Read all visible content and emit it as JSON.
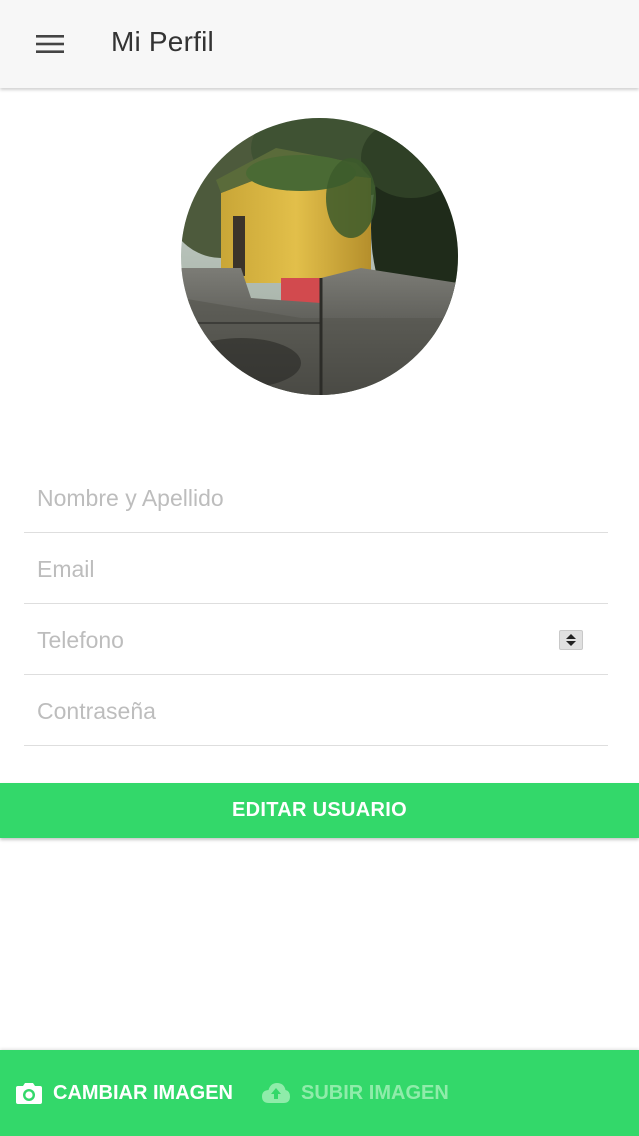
{
  "header": {
    "title": "Mi Perfil",
    "menu_icon": "hamburger-menu-icon",
    "background": "#f7f7f7"
  },
  "profile": {
    "avatar_alt": "Foto de perfil"
  },
  "form": {
    "name_placeholder": "Nombre y Apellido",
    "name_value": "",
    "email_placeholder": "Email",
    "email_value": "",
    "phone_placeholder": "Telefono",
    "phone_value": "",
    "password_placeholder": "Contraseña",
    "password_value": ""
  },
  "actions": {
    "edit_label": "EDITAR USUARIO"
  },
  "bottom_bar": {
    "change_image_label": "CAMBIAR IMAGEN",
    "change_image_icon": "camera-icon",
    "upload_image_label": "SUBIR IMAGEN",
    "upload_image_icon": "cloud-upload-icon",
    "upload_enabled": false
  },
  "colors": {
    "accent": "#33d86a",
    "disabled_text": "#8fecaa",
    "placeholder": "#bdbdbd",
    "divider": "#dedede"
  }
}
